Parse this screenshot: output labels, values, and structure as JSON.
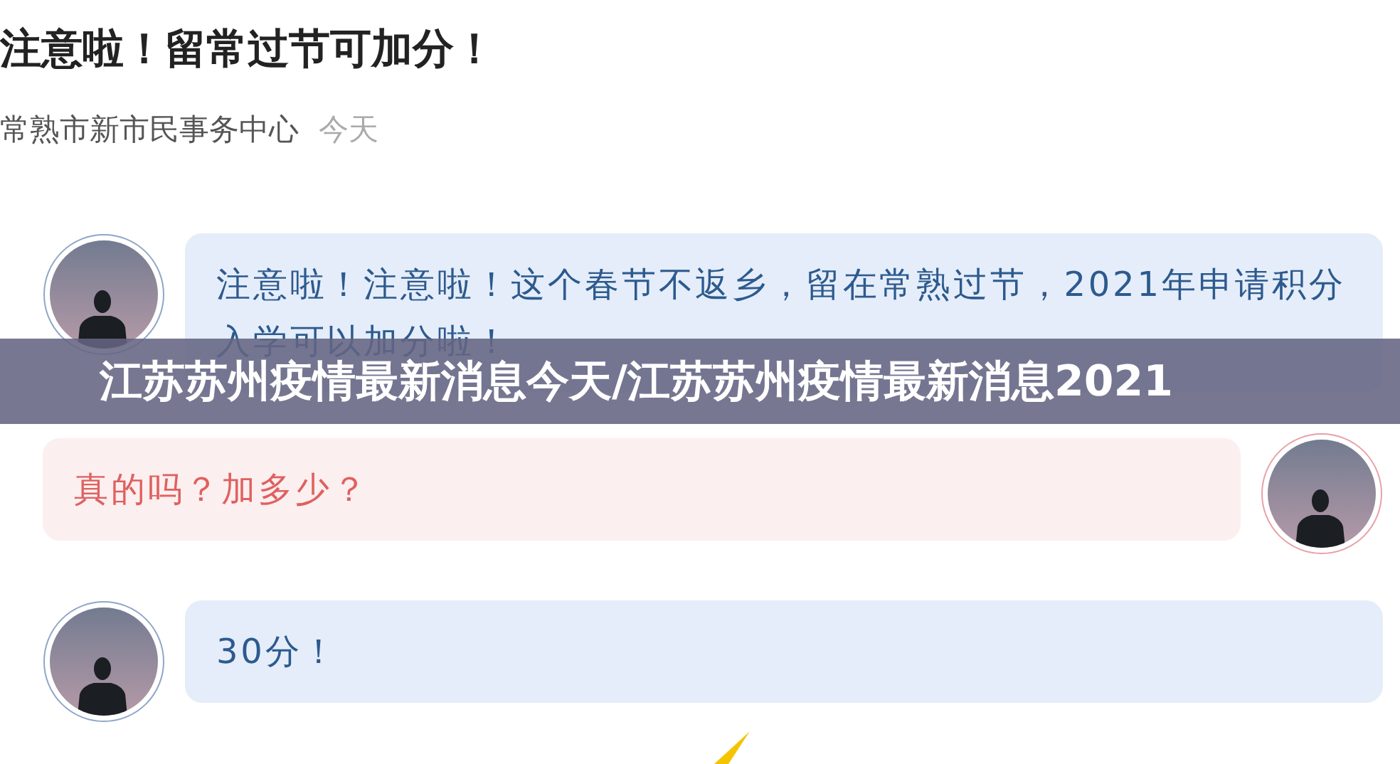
{
  "article": {
    "title": "注意啦！留常过节可加分！",
    "source": "常熟市新市民事务中心",
    "time": "今天"
  },
  "messages": [
    {
      "kind": "left",
      "text": "注意啦！注意啦！这个春节不返乡，留在常熟过节，2021年申请积分入学可以加分啦！"
    },
    {
      "kind": "right",
      "text": "真的吗？加多少？"
    },
    {
      "kind": "left",
      "text": "30分！"
    }
  ],
  "banner": {
    "text": "江苏苏州疫情最新消息今天/江苏苏州疫情最新消息2021"
  }
}
